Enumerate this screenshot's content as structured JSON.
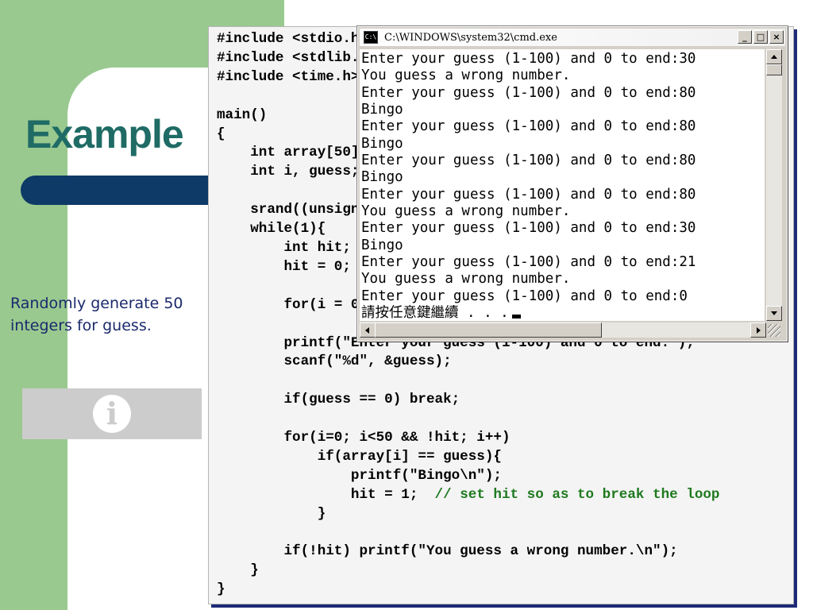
{
  "slide": {
    "title": "Example",
    "caption": "Randomly generate 50 integers for guess.",
    "info_icon": "info-icon",
    "colors": {
      "green_band": "#99c98f",
      "title": "#1f6b65",
      "blue_bar": "#0d3a66",
      "caption": "#1a2a6c",
      "comment": "#1f7a1f"
    }
  },
  "code": {
    "lines": [
      "#include <stdio.h>",
      "#include <stdlib.h>",
      "#include <time.h>",
      "",
      "main()",
      "{",
      "    int array[50];",
      "    int i, guess;",
      "",
      "    srand((unsigned)time(NULL));",
      "    while(1){",
      "        int hit;",
      "        hit = 0;",
      "",
      "        for(i = 0; i<50; i++) array[i] = rand()%100+1;",
      "",
      "        printf(\"Enter your guess (1-100) and 0 to end:\");",
      "        scanf(\"%d\", &guess);",
      "",
      "        if(guess == 0) break;",
      "",
      "        for(i=0; i<50 && !hit; i++)",
      "            if(array[i] == guess){",
      "                printf(\"Bingo\\n\");",
      "                hit = 1;  ",
      "            }",
      "",
      "        if(!hit) printf(\"You guess a wrong number.\\n\");",
      "    }",
      "}"
    ],
    "comment_text": "// set hit so as to break the loop"
  },
  "cmd": {
    "title": "C:\\WINDOWS\\system32\\cmd.exe",
    "icon": "cmd-icon",
    "lines": [
      "Enter your guess (1-100) and 0 to end:30",
      "You guess a wrong number.",
      "Enter your guess (1-100) and 0 to end:80",
      "Bingo",
      "Enter your guess (1-100) and 0 to end:80",
      "Bingo",
      "Enter your guess (1-100) and 0 to end:80",
      "Bingo",
      "Enter your guess (1-100) and 0 to end:80",
      "You guess a wrong number.",
      "Enter your guess (1-100) and 0 to end:30",
      "Bingo",
      "Enter your guess (1-100) and 0 to end:21",
      "You guess a wrong number.",
      "Enter your guess (1-100) and 0 to end:0"
    ],
    "prompt": "請按任意鍵繼續 . . .",
    "buttons": {
      "minimize": "_",
      "maximize": "□",
      "close": "×"
    }
  }
}
